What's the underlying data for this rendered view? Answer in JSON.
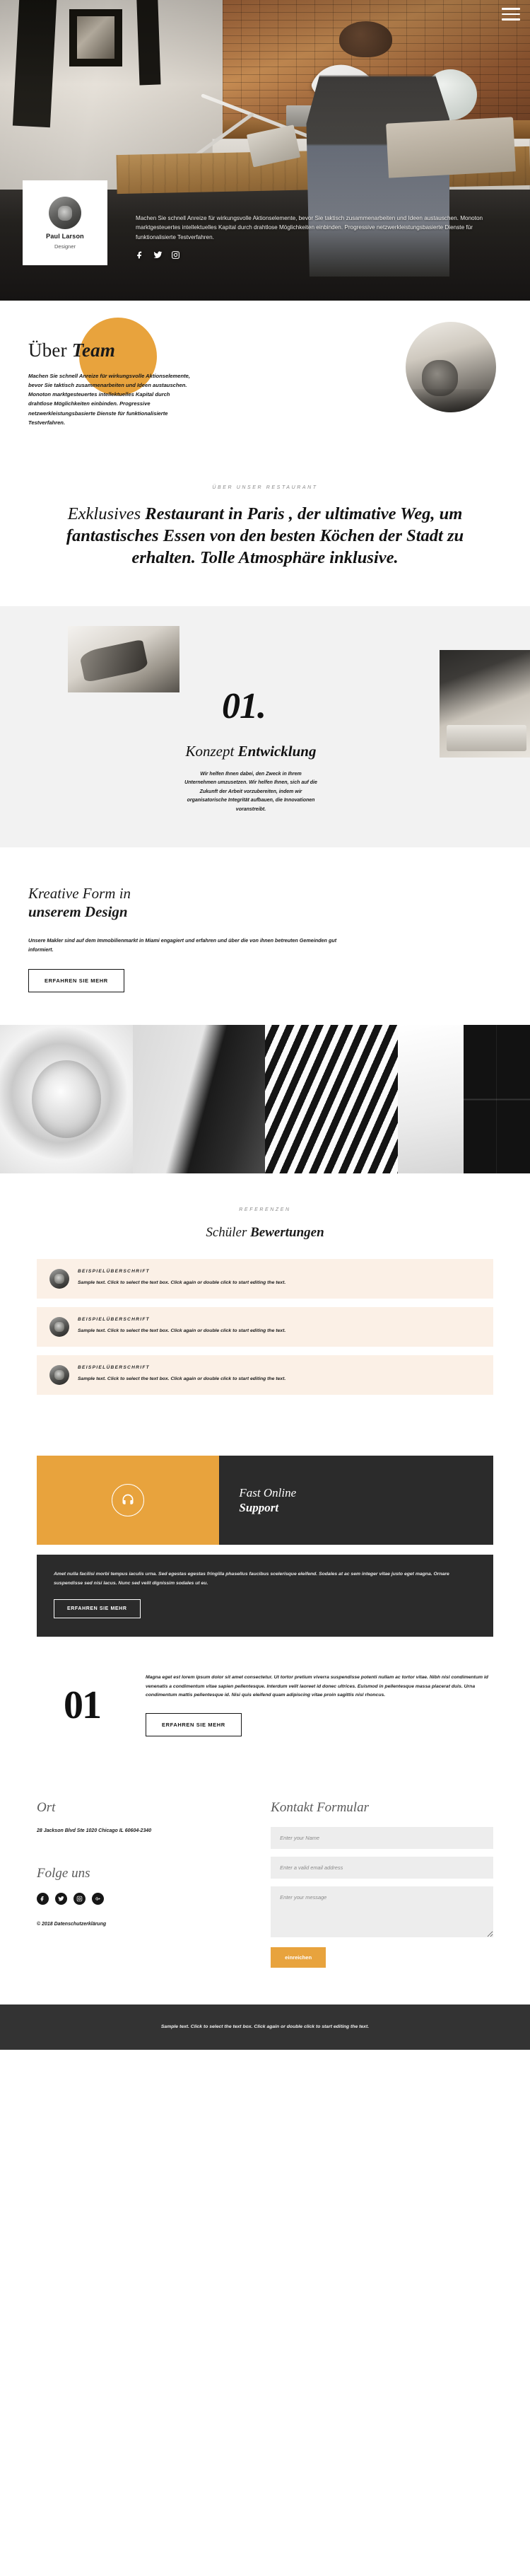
{
  "hero": {
    "menu_icon": "hamburger-menu-icon",
    "profile": {
      "name": "Paul Larson",
      "role": "Designer"
    },
    "paragraph": "Machen Sie schnell Anreize für wirkungsvolle Aktionselemente, bevor Sie taktisch zusammenarbeiten und Ideen austauschen. Monoton marktgesteuertes intellektuelles Kapital durch drahtlose Möglichkeiten einbinden. Progressive netzwerkleistungsbasierte Dienste für funktionalisierte Testverfahren.",
    "social": [
      "facebook-icon",
      "twitter-icon",
      "instagram-icon"
    ]
  },
  "about": {
    "title_light": "Über ",
    "title_bold": "Team",
    "body": "Machen Sie schnell Anreize für wirkungsvolle Aktionselemente, bevor Sie taktisch zusammenarbeiten und Ideen austauschen. Monoton marktgesteuertes intellektuelles Kapital durch drahtlose Möglichkeiten einbinden. Progressive netzwerkleistungsbasierte Dienste für funktionalisierte Testverfahren.",
    "accent_color": "#e8a33d"
  },
  "restaurant": {
    "eyebrow": "ÜBER UNSER RESTAURANT",
    "heading_light": "Exklusives ",
    "heading_bold": "Restaurant in Paris , der ultimative Weg, um fantastisches Essen von den besten Köchen der Stadt zu erhalten. Tolle Atmosphäre inklusive."
  },
  "konzept": {
    "number": "01.",
    "title_light": "Konzept ",
    "title_bold": "Entwicklung",
    "body": "Wir helfen Ihnen dabei, den Zweck in Ihrem Unternehmen umzusetzen. Wir helfen Ihnen, sich auf die Zukunft der Arbeit vorzubereiten, indem wir organisatorische Integrität aufbauen, die Innovationen voranstreibt."
  },
  "kreativ": {
    "title_light": "Kreative Form in",
    "title_bold": "unserem Design",
    "body": "Unsere Makler sind auf dem Immobilienmarkt in Miami engagiert und erfahren und über die von ihnen betreuten Gemeinden gut informiert.",
    "button": "ERFAHREN SIE MEHR"
  },
  "testimonials": {
    "eyebrow": "REFERENZEN",
    "title_light": "Schüler ",
    "title_bold": "Bewertungen",
    "cards": [
      {
        "heading": "BEISPIELÜBERSCHRIFT",
        "body": "Sample text. Click to select the text box. Click again or double click to start editing the text."
      },
      {
        "heading": "BEISPIELÜBERSCHRIFT",
        "body": "Sample text. Click to select the text box. Click again or double click to start editing the text."
      },
      {
        "heading": "BEISPIELÜBERSCHRIFT",
        "body": "Sample text. Click to select the text box. Click again or double click to start editing the text."
      }
    ]
  },
  "support": {
    "icon": "headset-support-icon",
    "title_light": "Fast Online",
    "title_bold": "Support",
    "body": "Amet nulla facilisi morbi tempus iaculis urna. Sed egestas egestas fringilla phasellus faucibus scelerisque eleifend. Sodales at ac sem integer vitae justo eget magna. Ornare suspendisse sed nisi lacus. Nunc sed velit dignissim sodales ut eu.",
    "button": "ERFAHREN SIE MEHR",
    "accent_color": "#e8a33d",
    "dark_color": "#2b2b2b"
  },
  "split": {
    "number": "01",
    "body": "Magna eget est lorem ipsum dolor sit amet consectetur. Ut tortor pretium viverra suspendisse potenti nullam ac tortor vitae. Nibh nisl condimentum id venenatis a condimentum vitae sapien pellentesque. Interdum velit laoreet id donec ultrices. Euismod in pellentesque massa placerat duis. Urna condimentum mattis pellentesque id. Nisi quis eleifend quam adipiscing vitae proin sagittis nisl rhoncus.",
    "button": "ERFAHREN SIE MEHR"
  },
  "contact": {
    "location_title": "Ort",
    "address": "28 Jackson Blvd Ste 1020 Chicago IL 60604-2340",
    "follow_title": "Folge uns",
    "social": [
      "facebook-icon",
      "twitter-icon",
      "instagram-icon",
      "google-plus-icon"
    ],
    "copyright": "© 2018 Datenschutzerklärung",
    "form_title": "Kontakt Formular",
    "name_placeholder": "Enter your Name",
    "email_placeholder": "Enter a valid email address",
    "message_placeholder": "Enter your message",
    "submit_label": "einreichen",
    "submit_color": "#e8a33d"
  },
  "footer": {
    "text": "Sample text. Click to select the text box. Click again or double click to start editing the text."
  }
}
